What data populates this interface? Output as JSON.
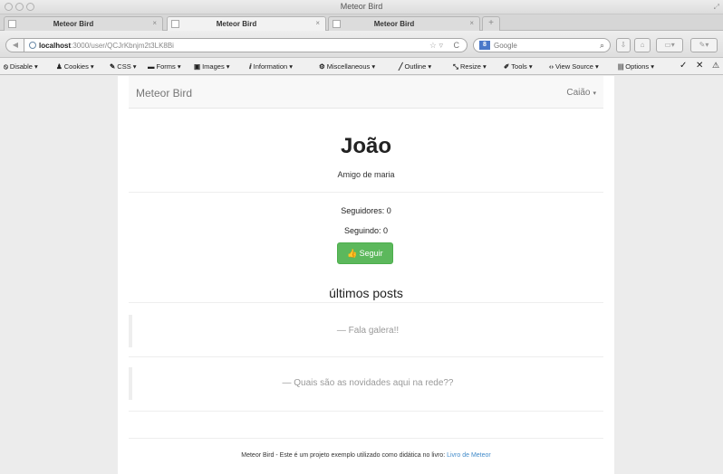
{
  "window": {
    "title": "Meteor Bird"
  },
  "tabs": [
    {
      "label": "Meteor Bird",
      "close": "×",
      "active": false
    },
    {
      "label": "Meteor Bird",
      "close": "×",
      "active": true
    },
    {
      "label": "Meteor Bird",
      "close": "×",
      "active": false
    }
  ],
  "newtab": "+",
  "address": {
    "host": "localhost",
    "path": ":3000/user/QCJrKbnjm2t3LK8Bi",
    "back": "◀",
    "star": "☆ ▿",
    "reload": "C"
  },
  "search": {
    "engine_logo": "8",
    "placeholder": "Google",
    "arrow": "▾",
    "icon": "search-icon"
  },
  "devtoolbar": {
    "items": [
      {
        "icon": "⦸",
        "label": "Disable ▾"
      },
      {
        "icon": "♟",
        "label": "Cookies ▾"
      },
      {
        "icon": "✎",
        "label": "CSS ▾"
      },
      {
        "icon": "▬",
        "label": "Forms ▾"
      },
      {
        "icon": "▣",
        "label": "Images ▾"
      },
      {
        "icon": "ⅈ",
        "label": "Information ▾"
      },
      {
        "icon": "⚙",
        "label": "Miscellaneous ▾"
      },
      {
        "icon": "╱",
        "label": "Outline ▾"
      },
      {
        "icon": "⤡",
        "label": "Resize ▾"
      },
      {
        "icon": "✐",
        "label": "Tools ▾"
      },
      {
        "icon": "‹›",
        "label": "View Source ▾"
      },
      {
        "icon": "|||",
        "label": "Options ▾"
      },
      {
        "icon": "✓",
        "label": ""
      },
      {
        "icon": "✕",
        "label": ""
      },
      {
        "icon": "⚠",
        "label": ""
      }
    ]
  },
  "site": {
    "brand": "Meteor Bird",
    "user": "Caião",
    "caret": "▾"
  },
  "profile": {
    "name": "João",
    "description": "Amigo de maria",
    "followers": "Seguidores: 0",
    "following": "Seguindo: 0",
    "follow_button": "Seguir",
    "follow_icon": "👍"
  },
  "posts": {
    "heading": "últimos posts",
    "items": [
      {
        "text": "— Fala galera!!"
      },
      {
        "text": "— Quais são as novidades aqui na rede??"
      }
    ]
  },
  "footer": {
    "text": "Meteor Bird - Este é um projeto exemplo utilizado como didática no livro: ",
    "link": "Livro de Meteor"
  }
}
